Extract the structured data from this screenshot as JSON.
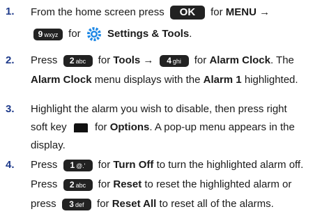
{
  "steps": [
    {
      "number": "1.",
      "lines": [
        {
          "pre": "From the home screen press",
          "key": "OK",
          "post1": " for ",
          "bold": "MENU",
          "post2": " →"
        },
        {
          "key": "9",
          "key_letters": "wxyz",
          "mid": " for ",
          "bold": "Settings & Tools",
          "post": "."
        }
      ]
    },
    {
      "number": "2.",
      "lines": [
        {
          "pre": "Press",
          "key1": "2",
          "key1_letters": "abc",
          "mid1": " for ",
          "bold1": "Tools",
          "arrow": " → ",
          "key2": "4",
          "key2_letters": "ghi",
          "mid2": " for ",
          "bold2": "Alarm Clock",
          "post": ". The"
        },
        {
          "bold1": "Alarm Clock",
          "mid": " menu displays with the ",
          "bold2": "Alarm 1",
          "post": " highlighted."
        }
      ]
    },
    {
      "number": "3.",
      "lines": [
        {
          "text": "Highlight the alarm you wish to disable, then press right"
        },
        {
          "pre": "soft key",
          "mid": " for ",
          "bold": "Options",
          "post": ". A pop-up menu appears in the"
        },
        {
          "text": "display."
        }
      ]
    },
    {
      "number": "4.",
      "lines": [
        {
          "pre": "Press",
          "key": "1",
          "key_letters": "@.'",
          "mid": " for ",
          "bold": "Turn Off",
          "post": " to turn the highlighted alarm off."
        },
        {
          "pre": "Press",
          "key": "2",
          "key_letters": "abc",
          "mid": " for ",
          "bold": "Reset",
          "post": " to reset the highlighted alarm or"
        },
        {
          "pre": "press",
          "key": "3",
          "key_letters": "def",
          "mid": " for ",
          "bold": "Reset All",
          "post": " to reset all of the alarms."
        }
      ]
    }
  ],
  "colors": {
    "number": "#1e3a8a",
    "key_bg": "#222222",
    "gear": "#1e88e5"
  },
  "icons": {
    "settings": "settings-gear-icon",
    "softkey": "right-softkey-icon"
  }
}
